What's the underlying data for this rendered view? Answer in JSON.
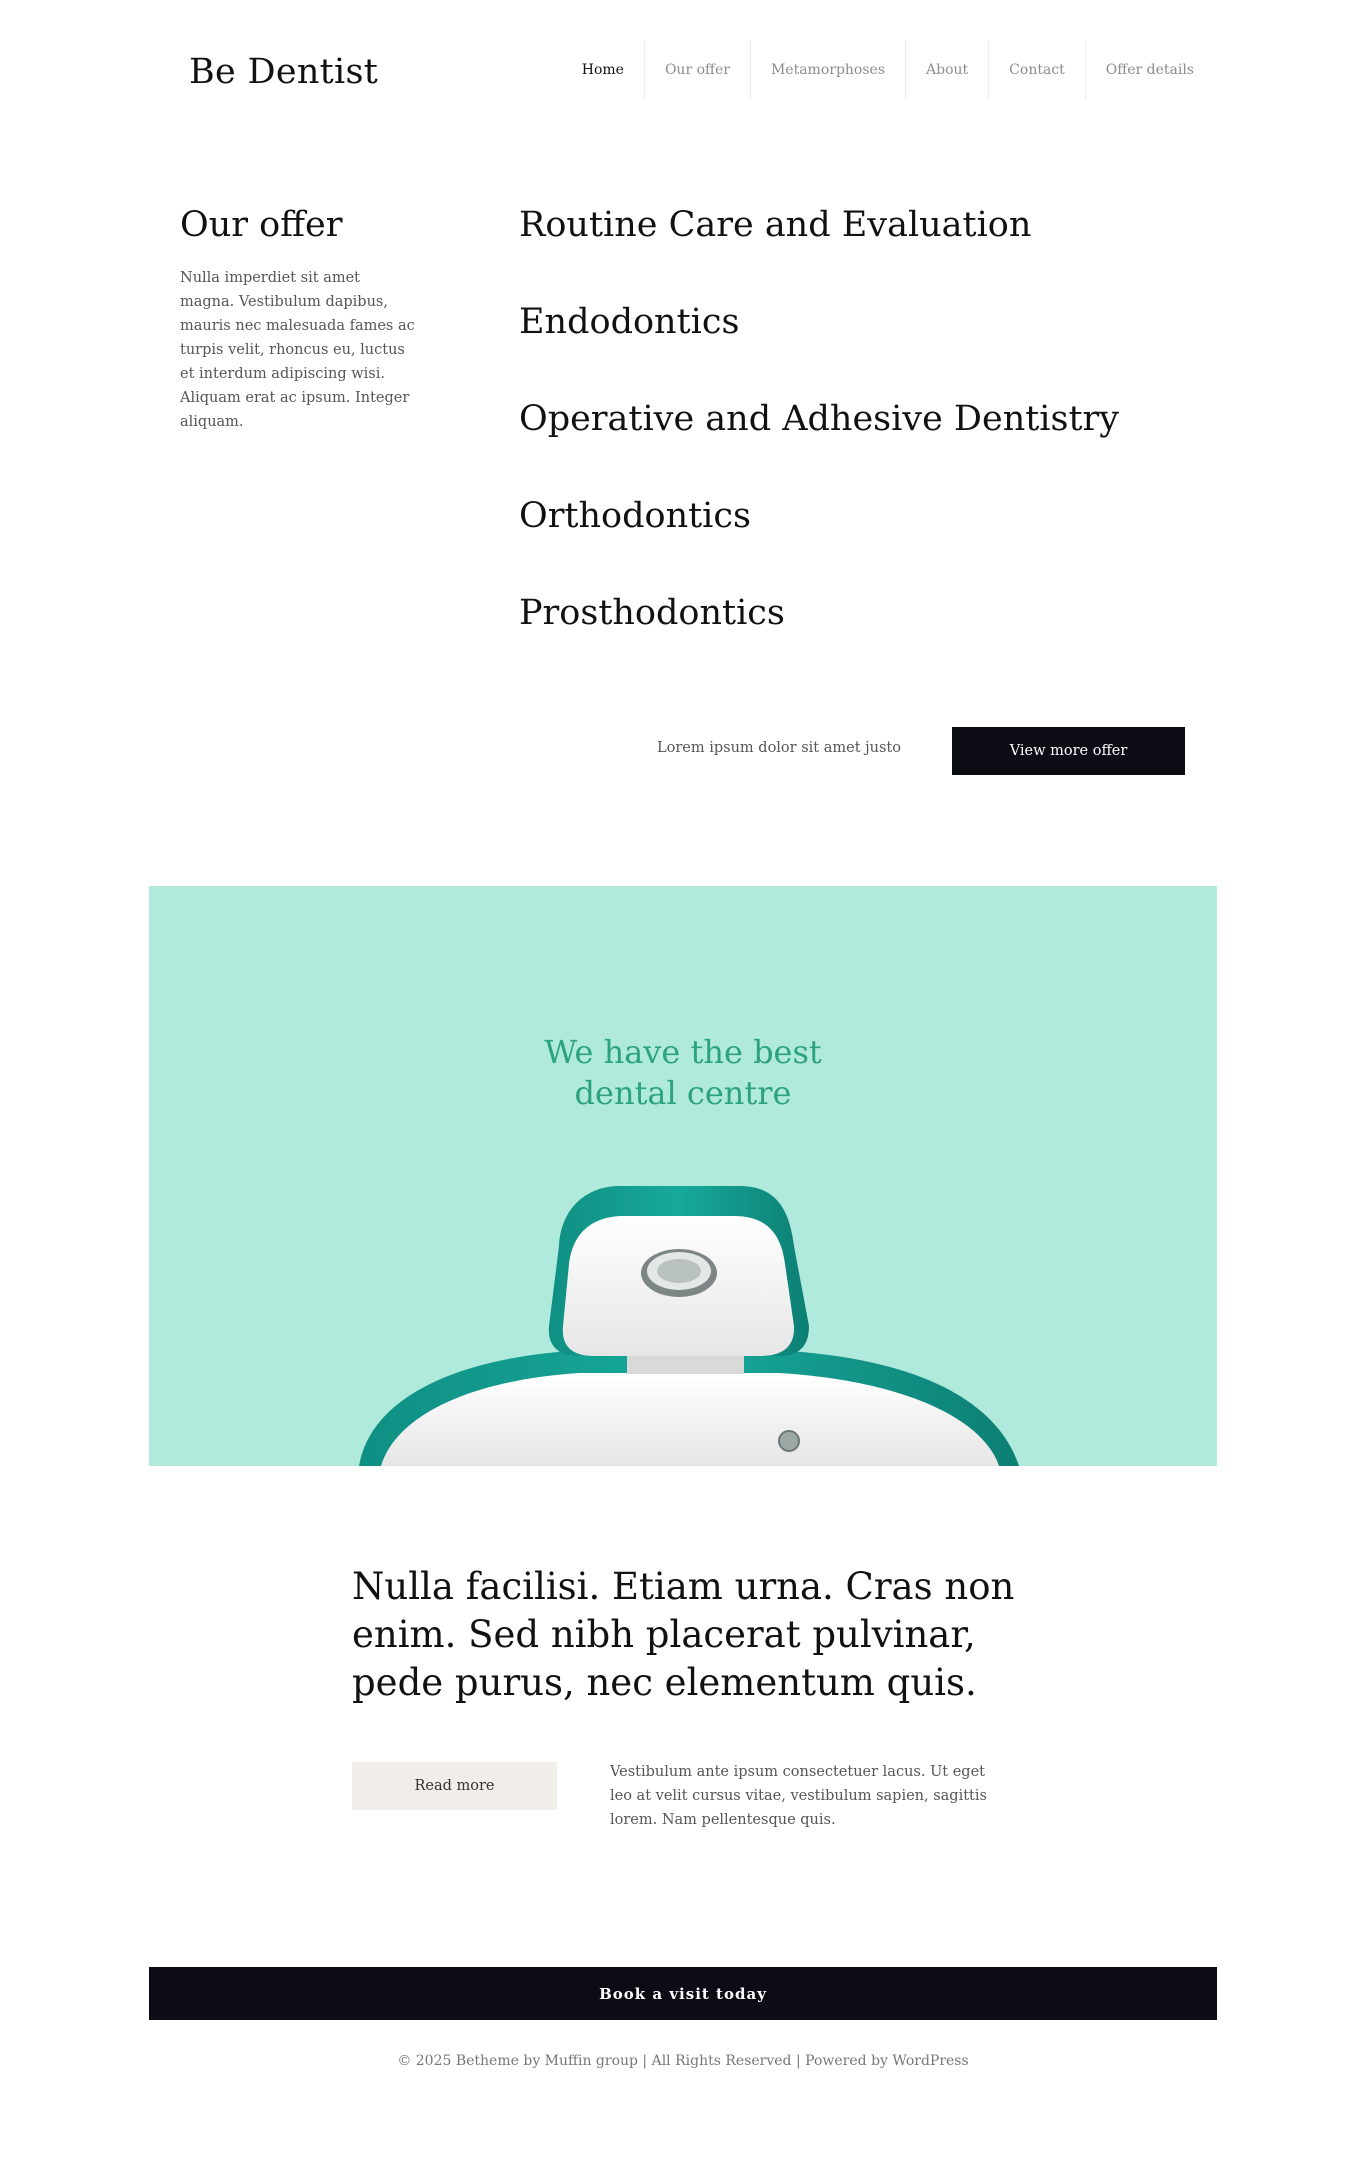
{
  "header": {
    "logo": "Be Dentist",
    "nav": [
      {
        "label": "Home",
        "active": true
      },
      {
        "label": "Our offer"
      },
      {
        "label": "Metamorphoses"
      },
      {
        "label": "About"
      },
      {
        "label": "Contact"
      },
      {
        "label": "Offer details"
      }
    ]
  },
  "offer": {
    "title": "Our offer",
    "description": "Nulla imperdiet sit amet magna. Vestibulum dapibus, mauris nec malesuada fames ac turpis velit, rhoncus eu, luctus et interdum adipiscing wisi. Aliquam erat ac ipsum. Integer aliquam.",
    "services": [
      "Routine Care and Evaluation",
      "Endodontics",
      "Operative and Adhesive Dentistry",
      "Orthodontics",
      "Prosthodontics"
    ],
    "cta_text": "Lorem ipsum dolor sit amet justo",
    "cta_button": "View more offer"
  },
  "banner": {
    "title_line1": "We have the best",
    "title_line2": "dental centre",
    "bg_color": "#b0eadc",
    "accent_color": "#2da37d"
  },
  "content": {
    "quote": "Nulla facilisi. Etiam urna. Cras non enim. Sed nibh placerat pulvinar, pede purus, nec elementum quis.",
    "read_more": "Read more",
    "text": "Vestibulum ante ipsum consectetuer lacus. Ut eget leo at velit cursus vitae, vestibulum sapien, sagittis lorem. Nam pellentesque quis."
  },
  "footer": {
    "book_button": "Book a visit today",
    "copyright": "© 2025 Betheme by Muffin group | All Rights Reserved | Powered by WordPress"
  }
}
